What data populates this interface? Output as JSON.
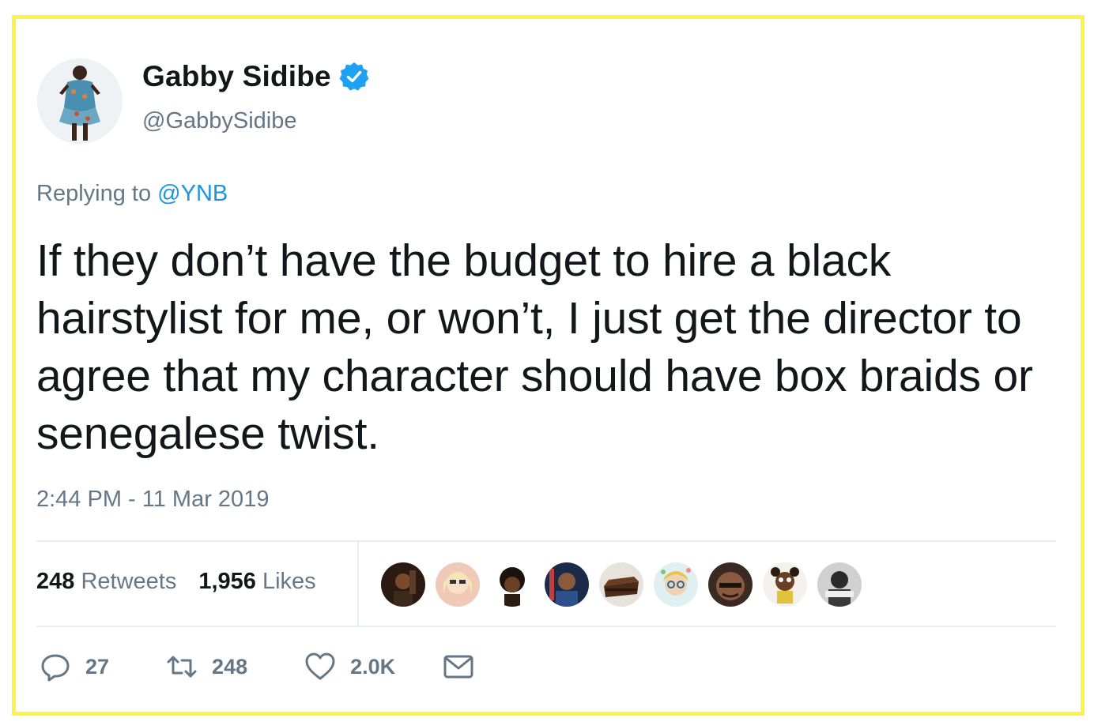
{
  "tweet": {
    "author_name": "Gabby Sidibe",
    "author_handle": "@GabbySidibe",
    "replying_prefix": "Replying to",
    "replying_to": "@YNB",
    "text": "If they don’t have the budget to hire a black hairstylist for me, or won’t, I just get the director to agree that my character should have box braids or senegalese twist.",
    "timestamp": "2:44 PM - 11 Mar 2019"
  },
  "stats": {
    "retweets_count": "248",
    "retweets_label": "Retweets",
    "likes_count": "1,956",
    "likes_label": "Likes"
  },
  "likers": [
    {
      "icon": "liker-avatar-1"
    },
    {
      "icon": "liker-avatar-2"
    },
    {
      "icon": "liker-avatar-3"
    },
    {
      "icon": "liker-avatar-4"
    },
    {
      "icon": "liker-avatar-5"
    },
    {
      "icon": "liker-avatar-6"
    },
    {
      "icon": "liker-avatar-7"
    },
    {
      "icon": "liker-avatar-8"
    },
    {
      "icon": "liker-avatar-9"
    }
  ],
  "actions": {
    "reply_count": "27",
    "retweet_count": "248",
    "like_count": "2.0K"
  },
  "colors": {
    "frame": "#fbf345",
    "link": "#1b95e0",
    "text": "#14171a",
    "muted": "#657786",
    "verified": "#1da1f2"
  }
}
